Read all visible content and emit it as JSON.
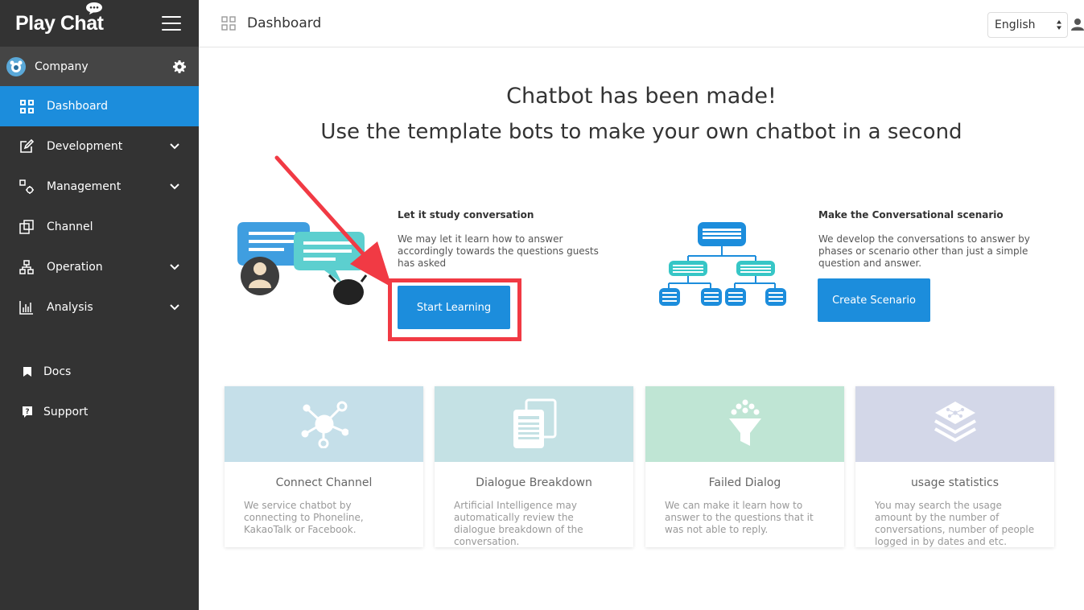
{
  "app": {
    "logo_text": "Play Chat"
  },
  "sidebar": {
    "company": "Company",
    "items": [
      {
        "label": "Dashboard",
        "icon": "grid-icon",
        "active": true,
        "expandable": false
      },
      {
        "label": "Development",
        "icon": "edit-icon",
        "active": false,
        "expandable": true
      },
      {
        "label": "Management",
        "icon": "gears-icon",
        "active": false,
        "expandable": true
      },
      {
        "label": "Channel",
        "icon": "channel-icon",
        "active": false,
        "expandable": false
      },
      {
        "label": "Operation",
        "icon": "hierarchy-icon",
        "active": false,
        "expandable": true
      },
      {
        "label": "Analysis",
        "icon": "bar-chart-icon",
        "active": false,
        "expandable": true
      }
    ],
    "links": [
      {
        "label": "Docs",
        "icon": "bookmark-icon"
      },
      {
        "label": "Support",
        "icon": "help-icon"
      }
    ]
  },
  "header": {
    "title": "Dashboard",
    "language": "English"
  },
  "main": {
    "headline": "Chatbot has been made!",
    "subheadline": "Use the template bots to make your own chatbot in a second",
    "features": [
      {
        "title": "Let it study conversation",
        "description": "We may let it learn how to answer accordingly towards the questions guests has asked",
        "button": "Start Learning"
      },
      {
        "title": "Make the Conversational scenario",
        "description": "We develop the conversations to answer by phases or scenario other than just a simple question and answer.",
        "button": "Create Scenario"
      }
    ],
    "cards": [
      {
        "title": "Connect Channel",
        "description": "We service chatbot by connecting to Phoneline, KakaoTalk or Facebook.",
        "color": "#c5dfe9"
      },
      {
        "title": "Dialogue Breakdown",
        "description": "Artificial Intelligence may automatically review the dialogue breakdown of the conversation.",
        "color": "#c4e1e4"
      },
      {
        "title": "Failed Dialog",
        "description": "We can make it learn how to answer to the questions that it was not able to reply.",
        "color": "#bfe5d4"
      },
      {
        "title": "usage statistics",
        "description": "You may search the usage amount by the number of conversations, number of people logged in by dates and etc.",
        "color": "#d3d7e8"
      }
    ]
  },
  "colors": {
    "accent": "#1c8ddc",
    "sidebar": "#333333",
    "highlight": "#f13a44"
  }
}
